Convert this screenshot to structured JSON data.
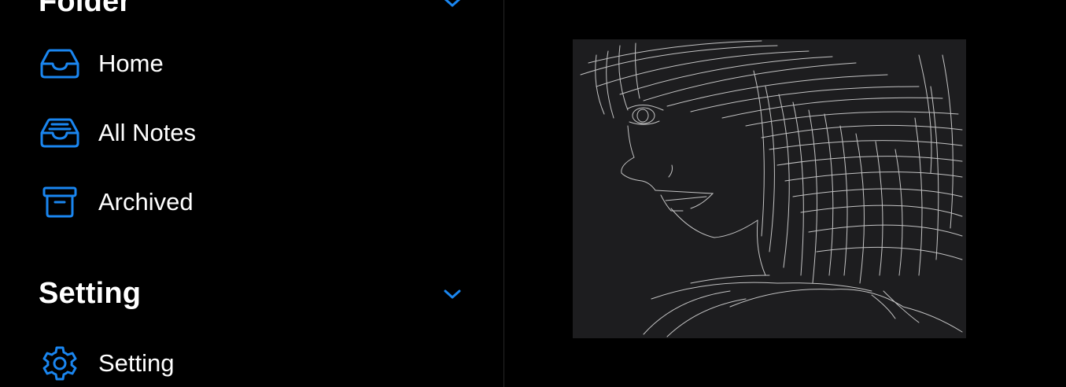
{
  "colors": {
    "accent": "#1a86f0",
    "background": "#000000",
    "drawing_background": "#1d1d1f",
    "sketch_stroke": "#d8d8d8"
  },
  "folder_section": {
    "title": "Folder",
    "items": [
      {
        "label": "Home",
        "icon": "tray-icon"
      },
      {
        "label": "All Notes",
        "icon": "tray-full-icon"
      },
      {
        "label": "Archived",
        "icon": "archive-box-icon"
      }
    ]
  },
  "setting_section": {
    "title": "Setting",
    "items": [
      {
        "label": "Setting",
        "icon": "gear-icon"
      }
    ]
  },
  "note_preview": {
    "image": "pencil-sketch-of-person-profile"
  }
}
